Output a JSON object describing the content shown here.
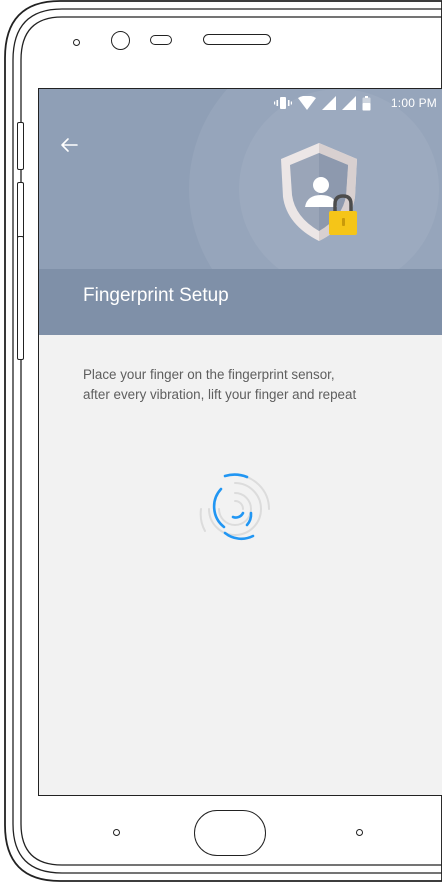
{
  "status_bar": {
    "time": "1:00 PM",
    "icons": [
      "vibrate-icon",
      "wifi-icon",
      "signal-icon",
      "signal-icon",
      "battery-icon"
    ]
  },
  "header": {
    "back_icon": "arrow-back-icon",
    "illustration": "shield-lock-icon",
    "title": "Fingerprint Setup"
  },
  "content": {
    "instruction_line_1": "Place your finger on the fingerprint sensor,",
    "instruction_line_2": "after every vibration, lift your finger and repeat",
    "fingerprint_icon": "fingerprint-icon"
  },
  "colors": {
    "header": "#8f9fb6",
    "title_band": "#7f90a8",
    "background": "#f2f2f2",
    "accent": "#2196f3",
    "lock": "#f5c518"
  }
}
